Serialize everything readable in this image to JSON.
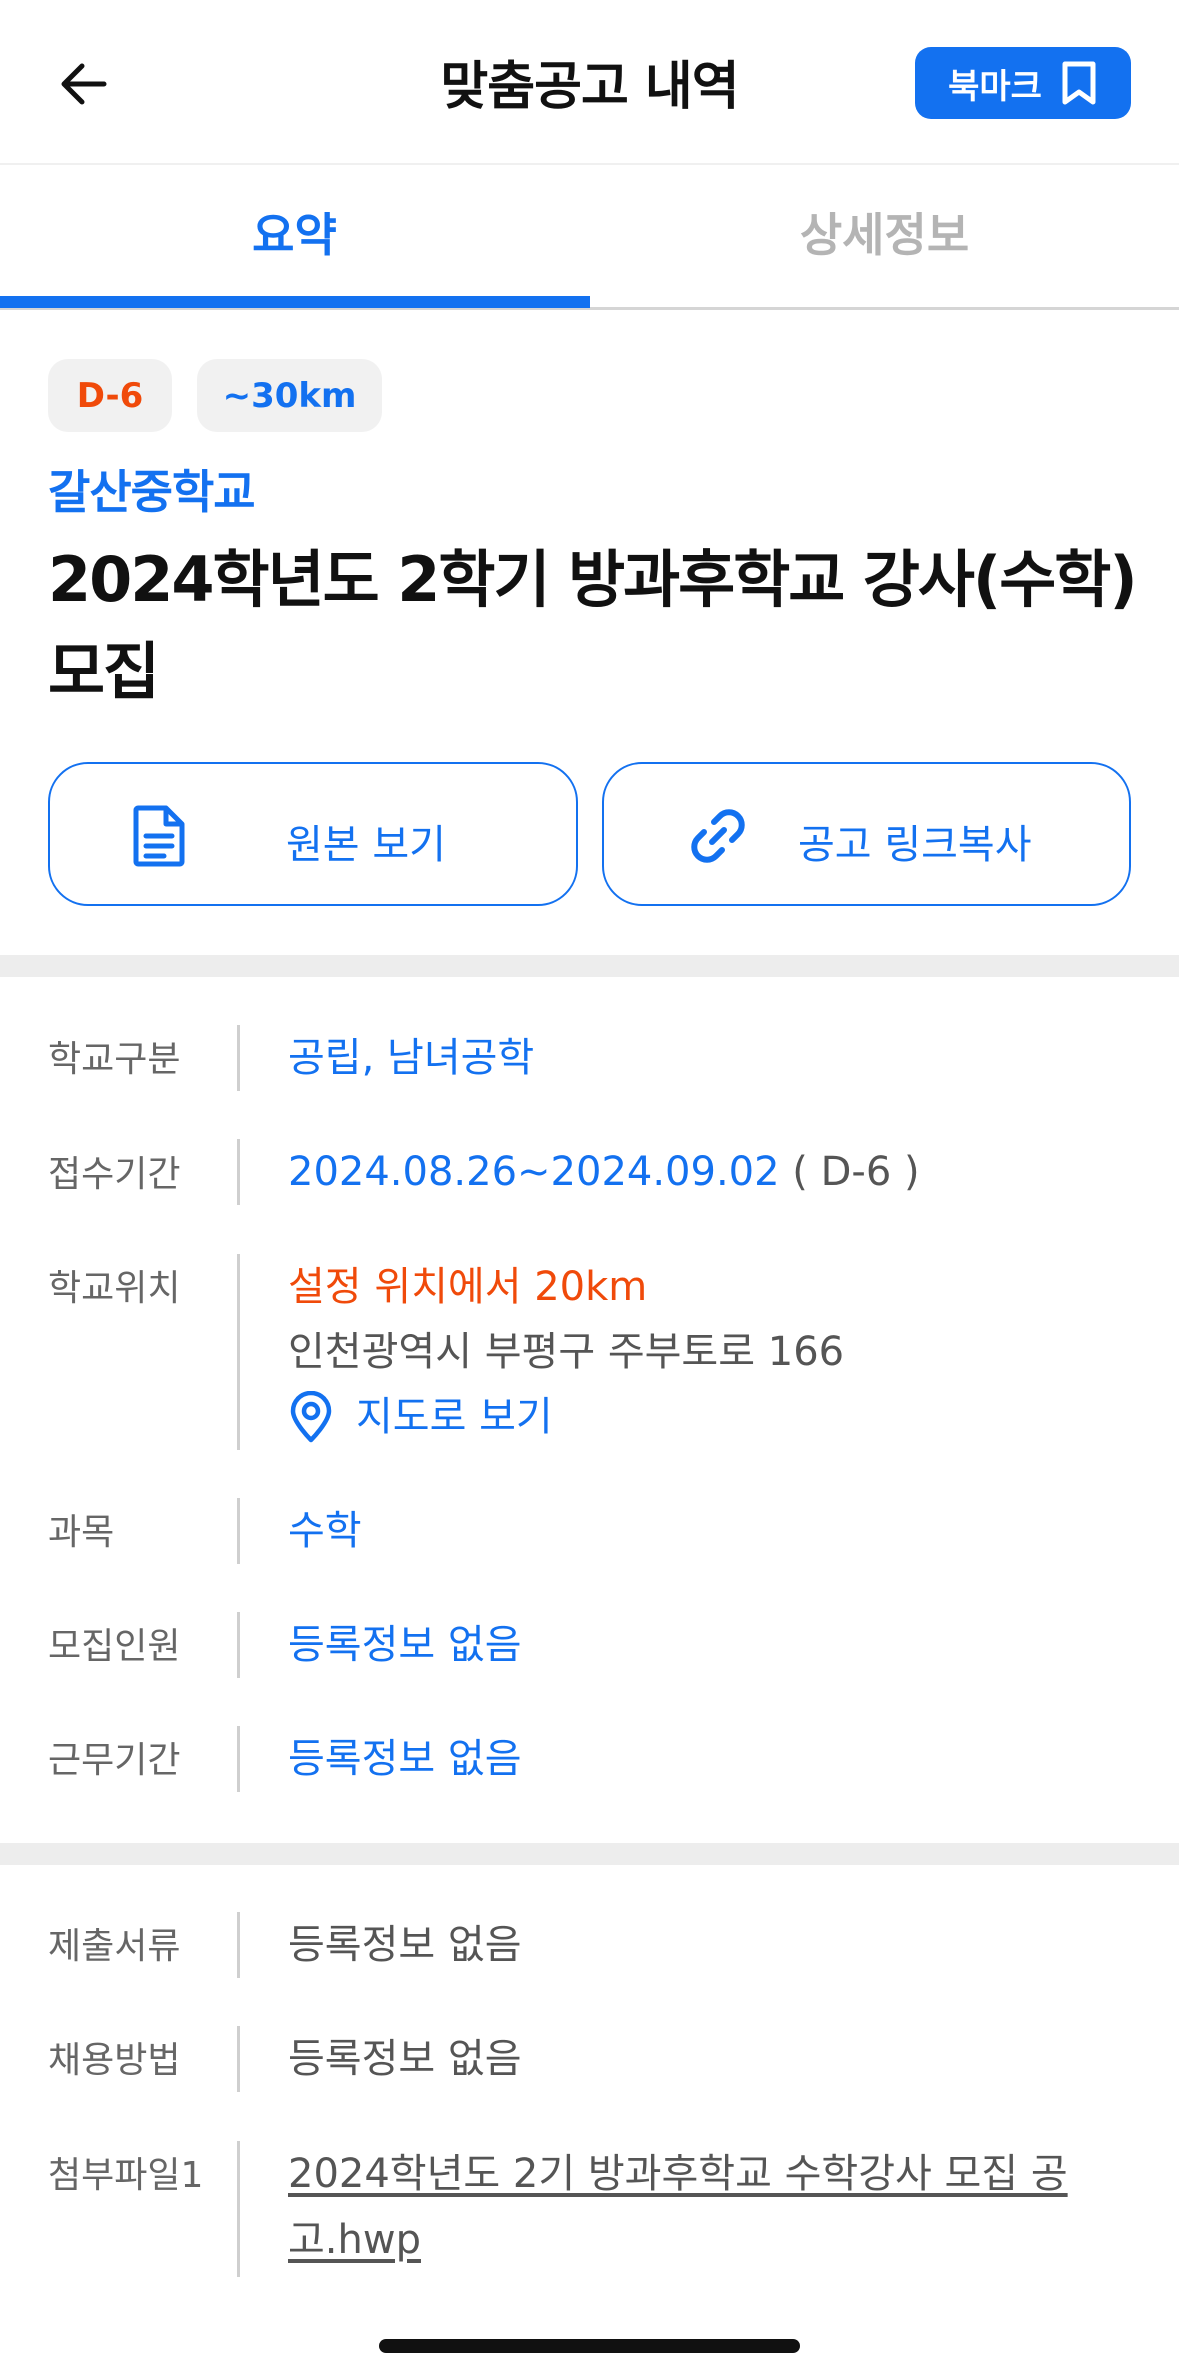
{
  "header": {
    "title": "맞춤공고 내역",
    "bookmark_label": "북마크"
  },
  "tabs": [
    {
      "label": "요약",
      "active": true
    },
    {
      "label": "상세정보",
      "active": false
    }
  ],
  "chips": {
    "dday": "D-6",
    "distance": "~30km"
  },
  "posting": {
    "school": "갈산중학교",
    "title": "2024학년도 2학기 방과후학교 강사(수학) 모집"
  },
  "actions": {
    "original_label": "원본 보기",
    "copy_label": "공고 링크복사"
  },
  "info": {
    "school_type": {
      "label": "학교구분",
      "value": "공립, 남녀공학"
    },
    "period": {
      "label": "접수기간",
      "value": "2024.08.26~2024.09.02",
      "suffix": "( D-6 )"
    },
    "location": {
      "label": "학교위치",
      "distance": "설정 위치에서 20km",
      "address": "인천광역시 부평구 주부토로 166",
      "map_label": "지도로 보기"
    },
    "subject": {
      "label": "과목",
      "value": "수학"
    },
    "headcount": {
      "label": "모집인원",
      "value": "등록정보 없음"
    },
    "work_period": {
      "label": "근무기간",
      "value": "등록정보 없음"
    }
  },
  "extra": {
    "documents": {
      "label": "제출서류",
      "value": "등록정보 없음"
    },
    "hiring": {
      "label": "채용방법",
      "value": "등록정보 없음"
    },
    "attachment": {
      "label": "첨부파일1",
      "value": "2024학년도 2기 방과후학교 수학강사 모집 공고.hwp"
    }
  },
  "colors": {
    "accent": "#1371f0",
    "warning": "#f04a0a",
    "divider": "#ededed"
  },
  "icons": [
    "back-arrow-icon",
    "bookmark-icon",
    "document-icon",
    "link-icon",
    "map-pin-icon"
  ]
}
